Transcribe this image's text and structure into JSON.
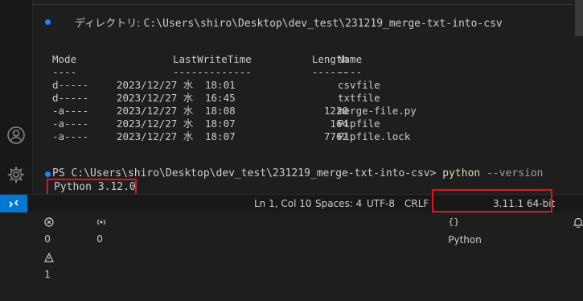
{
  "terminal": {
    "dir_label": "ディレクトリ: ",
    "dir_path": "C:\\Users\\shiro\\Desktop\\dev_test\\231219_merge-txt-into-csv",
    "headers": {
      "mode": "Mode",
      "time": "LastWriteTime",
      "length": "Length",
      "name": "Name"
    },
    "separators": {
      "mode": "----",
      "time": "-------------",
      "length": "------",
      "name": "----"
    },
    "rows": [
      {
        "mode": "d-----",
        "date": "2023/12/27 水",
        "time": "18:01",
        "length": "",
        "name": "csvfile"
      },
      {
        "mode": "d-----",
        "date": "2023/12/27 水",
        "time": "16:45",
        "length": "",
        "name": "txtfile"
      },
      {
        "mode": "-a----",
        "date": "2023/12/27 水",
        "time": "18:08",
        "length": "1220",
        "name": "merge-file.py"
      },
      {
        "mode": "-a----",
        "date": "2023/12/27 水",
        "time": "18:07",
        "length": "164",
        "name": "Pipfile"
      },
      {
        "mode": "-a----",
        "date": "2023/12/27 水",
        "time": "18:07",
        "length": "7762",
        "name": "Pipfile.lock"
      }
    ],
    "prompt": "PS C:\\Users\\shiro\\Desktop\\dev_test\\231219_merge-txt-into-csv>",
    "command": "python",
    "command_args": "--version",
    "output": "Python 3.12.0"
  },
  "statusbar": {
    "remote_icon": "remote-icon",
    "errors": "0",
    "warnings": "1",
    "ports": "0",
    "cursor": "Ln 1, Col 10",
    "spaces": "Spaces: 4",
    "encoding": "UTF-8",
    "eol": "CRLF",
    "language": "Python",
    "interpreter": "3.11.1 64-bit",
    "bell_icon": "bell-icon"
  },
  "colors": {
    "accent": "#0078d4",
    "highlight": "#e8121b",
    "dot": "#1a85ff"
  }
}
